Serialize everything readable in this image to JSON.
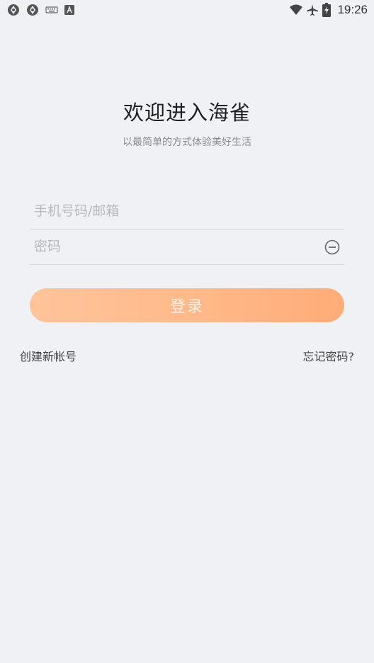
{
  "status_bar": {
    "time": "19:26",
    "left_icons": [
      "aperture-icon",
      "aperture-icon",
      "keyboard-icon",
      "font-a-icon"
    ],
    "right_icons": [
      "wifi-icon",
      "airplane-icon",
      "battery-charging-icon"
    ]
  },
  "header": {
    "title": "欢迎进入海雀",
    "subtitle": "以最简单的方式体验美好生活"
  },
  "form": {
    "account_placeholder": "手机号码/邮箱",
    "account_value": "",
    "password_placeholder": "密码",
    "password_value": "",
    "login_label": "登录"
  },
  "links": {
    "create_account": "创建新帐号",
    "forgot_password": "忘记密码?"
  },
  "colors": {
    "background": "#f0f1f5",
    "button_gradient_start": "#ffc49a",
    "button_gradient_end": "#ffac78",
    "button_text": "#fff1e6"
  }
}
